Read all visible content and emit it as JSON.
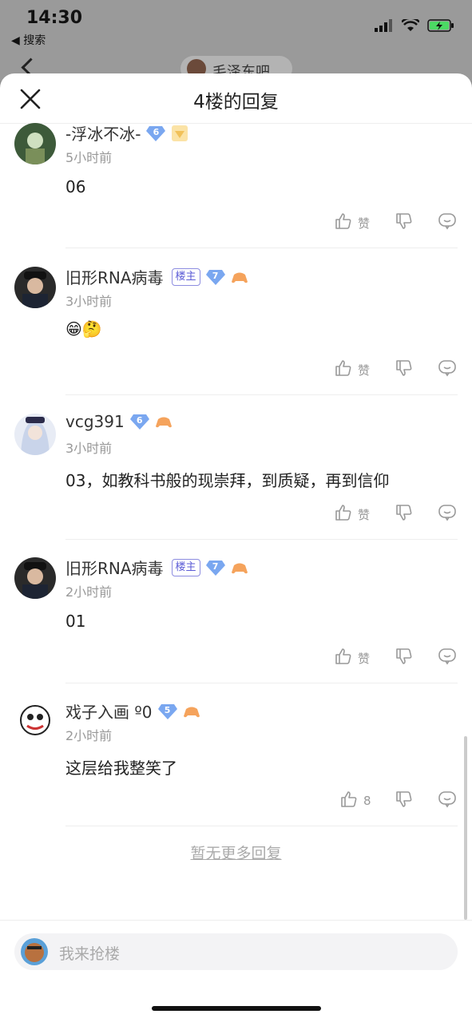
{
  "status_bar": {
    "time": "14:30",
    "back_app": "◀ 搜索"
  },
  "background_page": {
    "chip_text": "毛泽东吧"
  },
  "sheet": {
    "title": "4楼的回复"
  },
  "replies": [
    {
      "user": "-浮冰不冰-",
      "level": "6",
      "is_owner": false,
      "time": "5小时前",
      "content": "06",
      "like_label": "赞"
    },
    {
      "user": "旧形RNA病毒",
      "level": "7",
      "is_owner": true,
      "owner_tag": "楼主",
      "time": "3小时前",
      "content": "😁🤔",
      "like_label": "赞"
    },
    {
      "user": "vcg391",
      "level": "6",
      "is_owner": false,
      "time": "3小时前",
      "content": "03，如教科书般的现崇拜，到质疑，再到信仰",
      "like_label": "赞"
    },
    {
      "user": "旧形RNA病毒",
      "level": "7",
      "is_owner": true,
      "owner_tag": "楼主",
      "time": "2小时前",
      "content": "01",
      "like_label": "赞"
    },
    {
      "user": "戏子入画 º0",
      "level": "5",
      "is_owner": false,
      "time": "2小时前",
      "content": "这层给我整笑了",
      "like_label": "8"
    }
  ],
  "footer": {
    "no_more": "暂无更多回复",
    "input_placeholder": "我来抢楼"
  },
  "colors": {
    "level_badge": "#7aa7f0",
    "owner_tag": "#5b5bd6",
    "muted": "#999999"
  }
}
